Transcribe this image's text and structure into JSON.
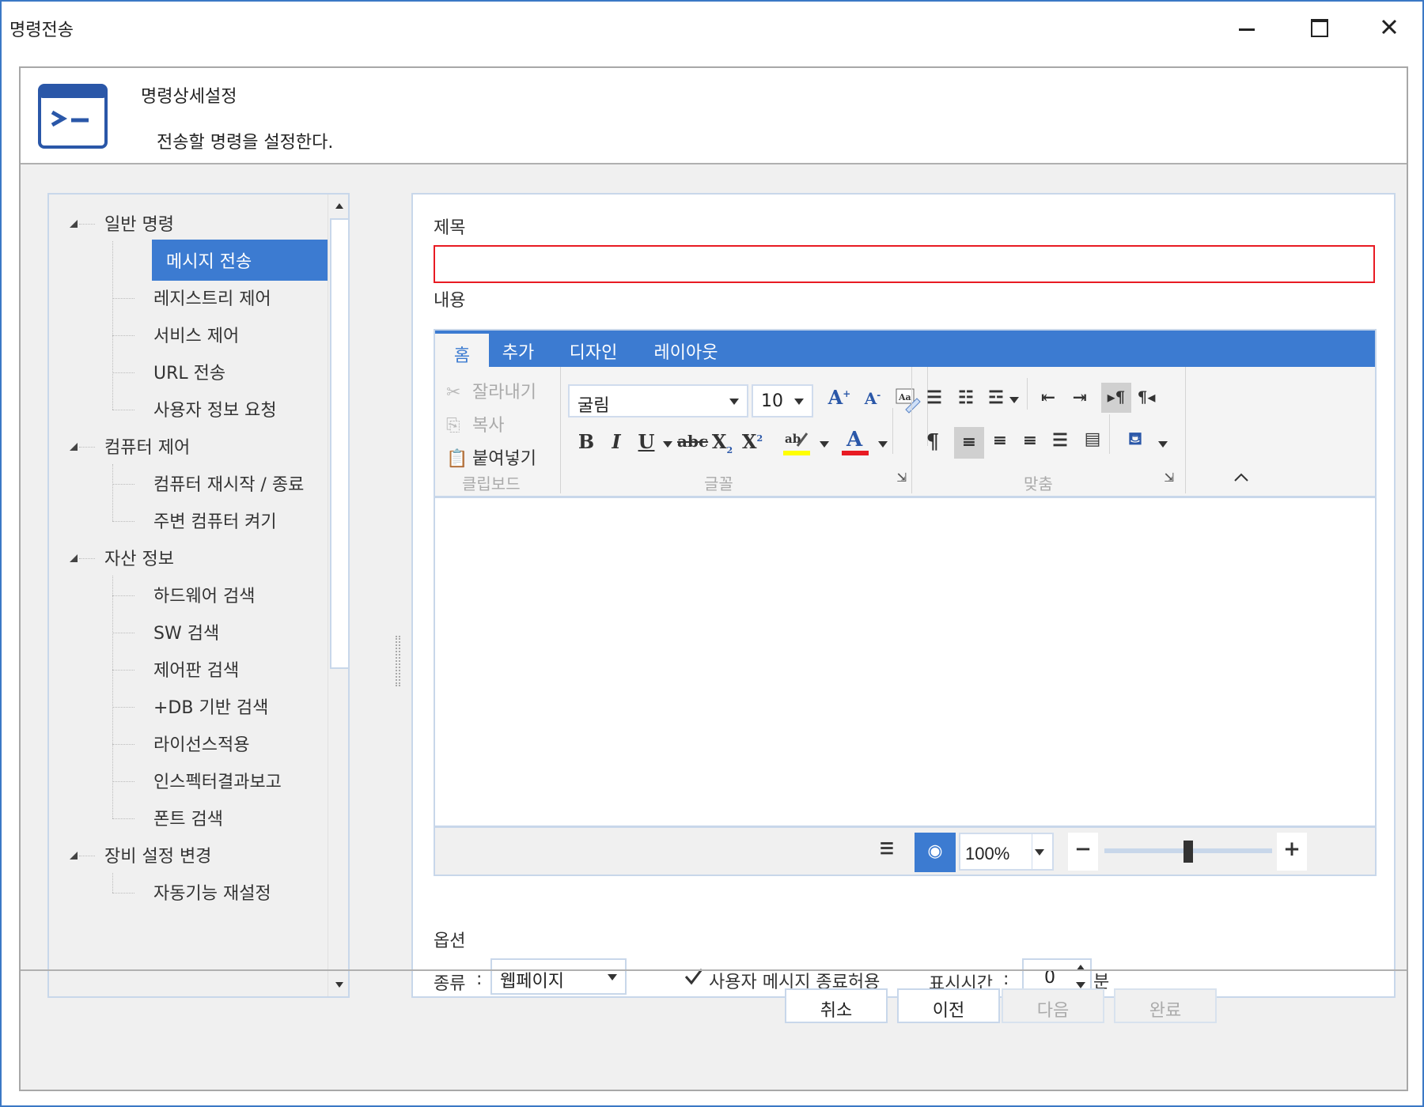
{
  "window": {
    "title": "명령전송"
  },
  "header": {
    "title": "명령상세설정",
    "subtitle": "전송할 명령을 설정한다."
  },
  "tree": {
    "groups": [
      {
        "label": "일반 명령",
        "items": [
          "메시지 전송",
          "레지스트리 제어",
          "서비스 제어",
          "URL 전송",
          "사용자 정보 요청"
        ]
      },
      {
        "label": "컴퓨터 제어",
        "items": [
          "컴퓨터 재시작 / 종료",
          "주변 컴퓨터 켜기"
        ]
      },
      {
        "label": "자산 정보",
        "items": [
          "하드웨어 검색",
          "SW 검색",
          "제어판 검색",
          "+DB 기반 검색",
          "라이선스적용",
          "인스펙터결과보고",
          "폰트 검색"
        ]
      },
      {
        "label": "장비 설정 변경",
        "items": [
          "자동기능 재설정"
        ]
      }
    ],
    "selected": "메시지 전송"
  },
  "form": {
    "title_label": "제목",
    "title_value": "",
    "content_label": "내용",
    "options_label": "옵션",
    "kind_label": "종류",
    "colon": ":",
    "kind_value": "웹페이지",
    "allow_close_label": "사용자 메시지 종료허용",
    "allow_close_checked": true,
    "display_time_label": "표시시간",
    "display_time_value": "0",
    "display_time_unit": "분"
  },
  "editor": {
    "tabs": [
      "홈",
      "추가",
      "디자인",
      "레이아웃"
    ],
    "active_tab": "홈",
    "clipboard": {
      "cut": "잘라내기",
      "copy": "복사",
      "paste": "붙여넣기",
      "group": "클립보드"
    },
    "font": {
      "name": "굴림",
      "size": "10",
      "group": "글꼴"
    },
    "paragraph_group": "맞춤",
    "zoom": "100%",
    "zoom_level": 0.5,
    "highlight_color": "#ffff00",
    "font_color": "#e81b23"
  },
  "buttons": {
    "cancel": "취소",
    "prev": "이전",
    "next": "다음",
    "finish": "완료"
  },
  "colors": {
    "accent": "#3c7bd1",
    "required": "#e81b23"
  }
}
